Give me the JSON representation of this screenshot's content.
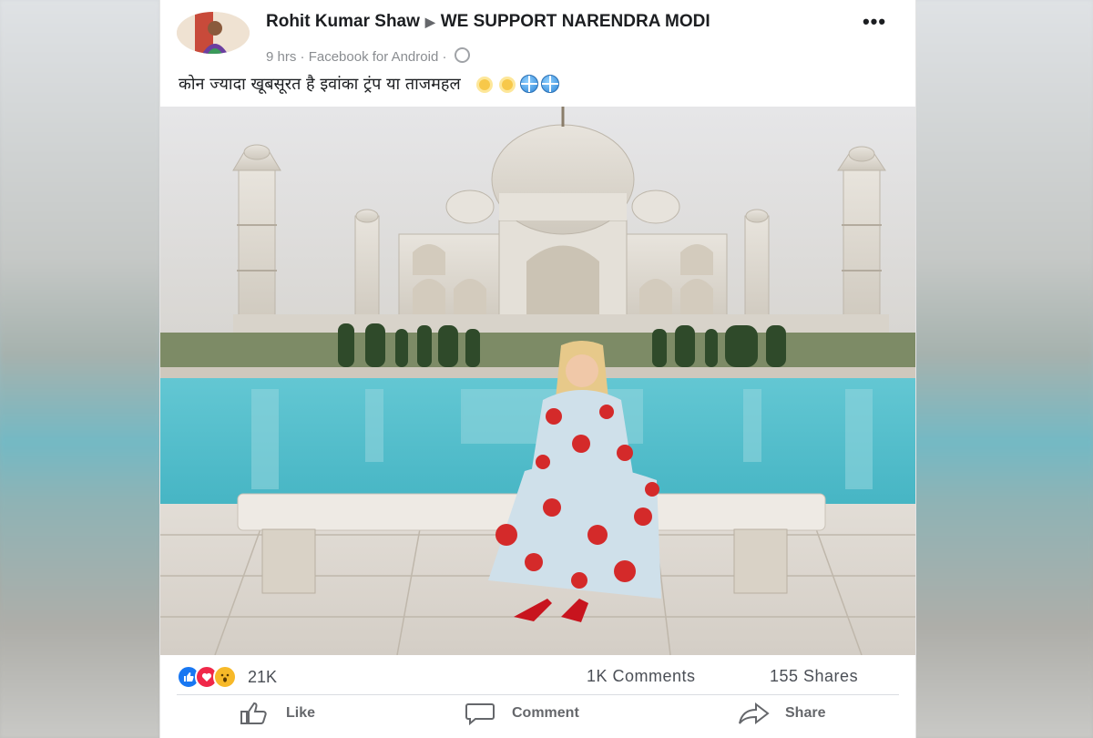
{
  "post": {
    "author": "Rohit Kumar Shaw",
    "group": "WE SUPPORT NARENDRA MODI",
    "time": "9 hrs",
    "source": "Facebook for Android",
    "separator": " · ",
    "text": "कोन ज्यादा खूबसूरत है इवांका ट्रंप या ताजमहल",
    "emojis": [
      "sun-icon",
      "sun-icon",
      "globe-icon",
      "globe-icon"
    ],
    "more": "•••"
  },
  "stats": {
    "reactions": "21K",
    "comments": "1K Comments",
    "shares": "155 Shares"
  },
  "actions": {
    "like": "Like",
    "comment": "Comment",
    "share": "Share"
  },
  "colors": {
    "like_blue": "#1877f2",
    "love_red": "#f02849",
    "wow_yellow": "#f7b928",
    "text_gray": "#65676b"
  }
}
